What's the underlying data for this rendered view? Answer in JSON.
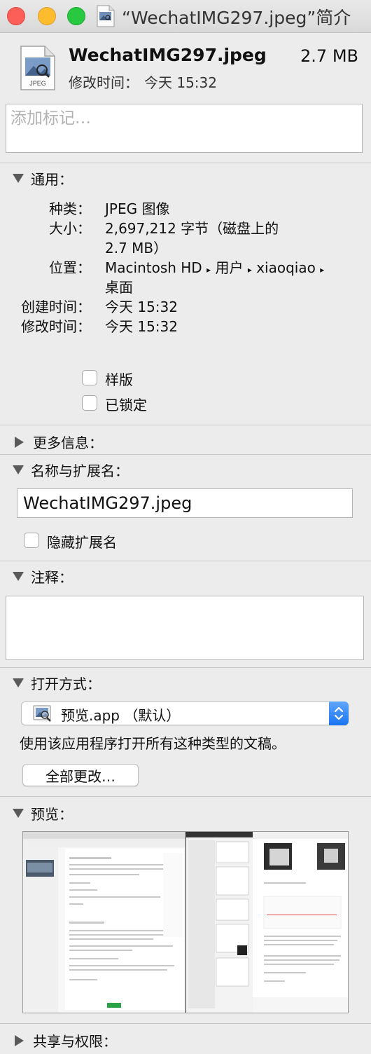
{
  "window": {
    "title": "“WechatIMG297.jpeg”简介",
    "buttons": {
      "close": "close",
      "minimize": "minimize",
      "zoom": "zoom"
    }
  },
  "file": {
    "name": "WechatIMG297.jpeg",
    "size": "2.7 MB",
    "icon_label": "JPEG",
    "modified_label": "修改时间：",
    "modified_value": "今天 15:32"
  },
  "tags": {
    "placeholder": "添加标记…"
  },
  "general": {
    "header": "通用：",
    "kind_label": "种类：",
    "kind_value": "JPEG 图像",
    "size_label": "大小：",
    "size_value_line1": "2,697,212 字节（磁盘上的",
    "size_value_line2": "2.7 MB）",
    "where_label": "位置：",
    "where_path": [
      "Macintosh HD",
      "用户",
      "xiaoqiao"
    ],
    "where_line2": "桌面",
    "created_label": "创建时间：",
    "created_value": "今天 15:32",
    "modified_label": "修改时间：",
    "modified_value": "今天 15:32",
    "stationery_label": "样版",
    "locked_label": "已锁定"
  },
  "more_info": {
    "header": "更多信息："
  },
  "name_ext": {
    "header": "名称与扩展名：",
    "value": "WechatIMG297.jpeg",
    "hide_ext_label": "隐藏扩展名"
  },
  "comments": {
    "header": "注释："
  },
  "open_with": {
    "header": "打开方式：",
    "app": "预览.app （默认）",
    "description": "使用该应用程序打开所有这种类型的文稿。",
    "change_all_button": "全部更改…"
  },
  "preview": {
    "header": "预览："
  },
  "sharing": {
    "header": "共享与权限："
  }
}
